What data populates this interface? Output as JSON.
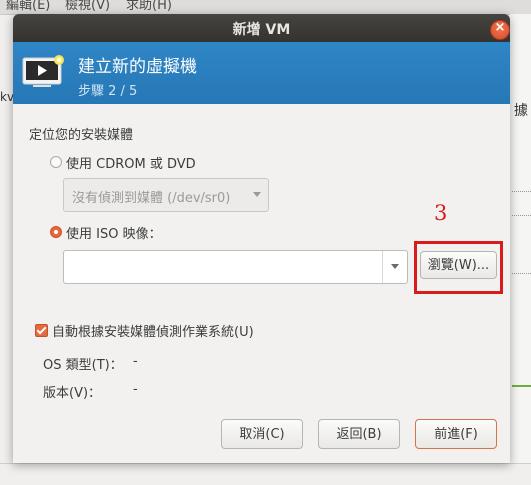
{
  "background": {
    "menu": [
      "編輯(E)",
      "檢視(V)",
      "求助(H)"
    ],
    "left_fragment": "kv",
    "right_fragment": "據"
  },
  "dialog": {
    "title": "新增 VM",
    "close_glyph": "×",
    "banner": {
      "title": "建立新的虛擬機",
      "step": "步驟 2 / 5"
    },
    "section_label": "定位您的安裝媒體",
    "cdrom": {
      "label": "使用 CDROM 或 DVD",
      "selected": false,
      "combo_value": "沒有偵測到媒體 (/dev/sr0)"
    },
    "iso": {
      "label": "使用 ISO 映像：",
      "selected": true,
      "path_value": "",
      "browse_label": "瀏覽(W)..."
    },
    "auto_detect": {
      "label": "自動根據安裝媒體偵測作業系統(U)",
      "checked": true
    },
    "os_type": {
      "label": "OS 類型(T)：",
      "value": "-"
    },
    "version": {
      "label": "版本(V)：",
      "value": "-"
    },
    "buttons": {
      "cancel": "取消(C)",
      "back": "返回(B)",
      "forward": "前進(F)"
    }
  },
  "annotation": {
    "number": "3",
    "color": "#d81c1c"
  },
  "colors": {
    "titlebar": "#3b3a36",
    "banner": "#2b7fbf",
    "accent": "#e56a3d"
  }
}
